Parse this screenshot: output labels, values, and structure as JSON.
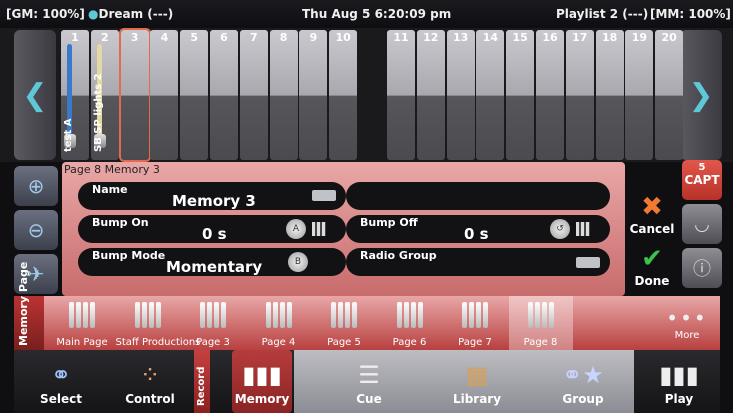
{
  "status": {
    "gm": "[GM: 100%]",
    "show": "Dream (---)",
    "datetime": "Thu Aug 5 6:20:09 pm",
    "playlist": "Playlist 2 (---)",
    "mm": "[MM: 100%]"
  },
  "faders": [
    {
      "num": "1",
      "label": "test A",
      "track_color": "#3a78c8"
    },
    {
      "num": "2",
      "label": "SB SP lights 2",
      "track_color": "#e4d9a2"
    },
    {
      "num": "3",
      "label": "",
      "selected": true
    },
    {
      "num": "4"
    },
    {
      "num": "5"
    },
    {
      "num": "6"
    },
    {
      "num": "7"
    },
    {
      "num": "8"
    },
    {
      "num": "9"
    },
    {
      "num": "10"
    },
    {
      "num": "11"
    },
    {
      "num": "12"
    },
    {
      "num": "13"
    },
    {
      "num": "14"
    },
    {
      "num": "15"
    },
    {
      "num": "16"
    },
    {
      "num": "17"
    },
    {
      "num": "18"
    },
    {
      "num": "19"
    },
    {
      "num": "20"
    }
  ],
  "panel": {
    "title": "Page 8 Memory 3",
    "name_label": "Name",
    "name_value": "Memory 3",
    "bump_on_label": "Bump On",
    "bump_on_value": "0 s",
    "bump_off_label": "Bump Off",
    "bump_off_value": "0 s",
    "bump_mode_label": "Bump Mode",
    "bump_mode_value": "Momentary",
    "radio_group_label": "Radio Group"
  },
  "actions": {
    "capt_num": "5",
    "capt_label": "CAPT",
    "cancel": "Cancel",
    "done": "Done"
  },
  "memory_page": {
    "side_label": "Memory Page",
    "items": [
      {
        "label": "Main Page"
      },
      {
        "label": "Staff Productions"
      },
      {
        "label": "Page 3"
      },
      {
        "label": "Page 4"
      },
      {
        "label": "Page 5"
      },
      {
        "label": "Page 6"
      },
      {
        "label": "Page 7"
      },
      {
        "label": "Page 8",
        "active": true
      }
    ],
    "more": "More"
  },
  "bottom": {
    "select": "Select",
    "control": "Control",
    "record_tab": "Record",
    "memory": "Memory",
    "cue": "Cue",
    "library": "Library",
    "group": "Group",
    "play": "Play"
  },
  "colors": {
    "accent_red": "#c84040",
    "arrow_cyan": "#5ec8d8",
    "cancel_orange": "#f07a30",
    "done_green": "#3ac24a"
  }
}
